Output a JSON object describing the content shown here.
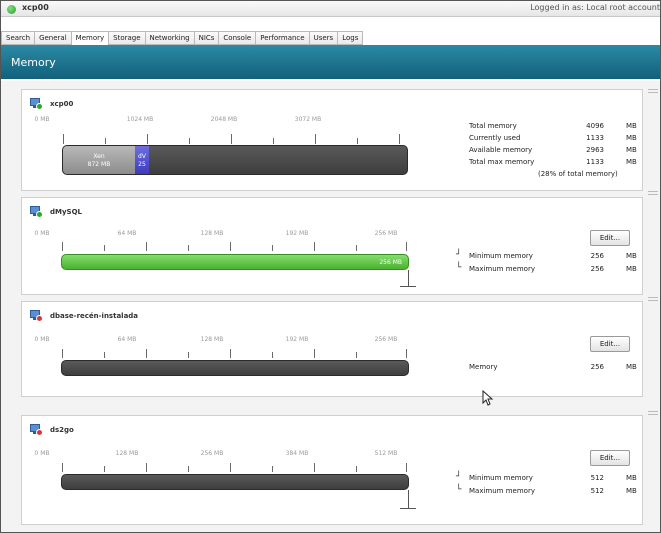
{
  "titlebar": {
    "host_name": "xcp00",
    "login_text": "Logged in as: Local root account"
  },
  "tabs": [
    "Search",
    "General",
    "Memory",
    "Storage",
    "Networking",
    "NICs",
    "Console",
    "Performance",
    "Users",
    "Logs"
  ],
  "active_tab": "Memory",
  "header": {
    "title": "Memory"
  },
  "host_panel": {
    "name": "xcp00",
    "scale": [
      "0 MB",
      "1024 MB",
      "2048 MB",
      "3072 MB"
    ],
    "xen_label": "Xen",
    "xen_value": "872 MB",
    "vm_label": "dV",
    "vm_value": "25",
    "stats": [
      {
        "label": "Total memory",
        "value": "4096",
        "unit": "MB"
      },
      {
        "label": "Currently used",
        "value": "1133",
        "unit": "MB"
      },
      {
        "label": "Available memory",
        "value": "2963",
        "unit": "MB"
      },
      {
        "label": "Total max memory",
        "value": "1133",
        "unit": "MB"
      }
    ],
    "note": "(28% of total memory)"
  },
  "vm_panels": [
    {
      "name": "dMySQL",
      "status": "running",
      "scale": [
        "0 MB",
        "64 MB",
        "128 MB",
        "192 MB",
        "256 MB"
      ],
      "bar_label": "256 MB",
      "edit_label": "Edit...",
      "stats": [
        {
          "label": "Minimum memory",
          "value": "256",
          "unit": "MB"
        },
        {
          "label": "Maximum memory",
          "value": "256",
          "unit": "MB"
        }
      ]
    },
    {
      "name": "dbase-recén-instalada",
      "status": "halted",
      "scale": [
        "0 MB",
        "64 MB",
        "128 MB",
        "192 MB",
        "256 MB"
      ],
      "bar_label": "",
      "edit_label": "Edit...",
      "stats": [
        {
          "label": "Memory",
          "value": "256",
          "unit": "MB"
        }
      ]
    },
    {
      "name": "ds2go",
      "status": "halted",
      "scale": [
        "0 MB",
        "128 MB",
        "256 MB",
        "384 MB",
        "512 MB"
      ],
      "bar_label": "",
      "edit_label": "Edit...",
      "stats": [
        {
          "label": "Minimum memory",
          "value": "512",
          "unit": "MB"
        },
        {
          "label": "Maximum memory",
          "value": "512",
          "unit": "MB"
        }
      ]
    }
  ]
}
